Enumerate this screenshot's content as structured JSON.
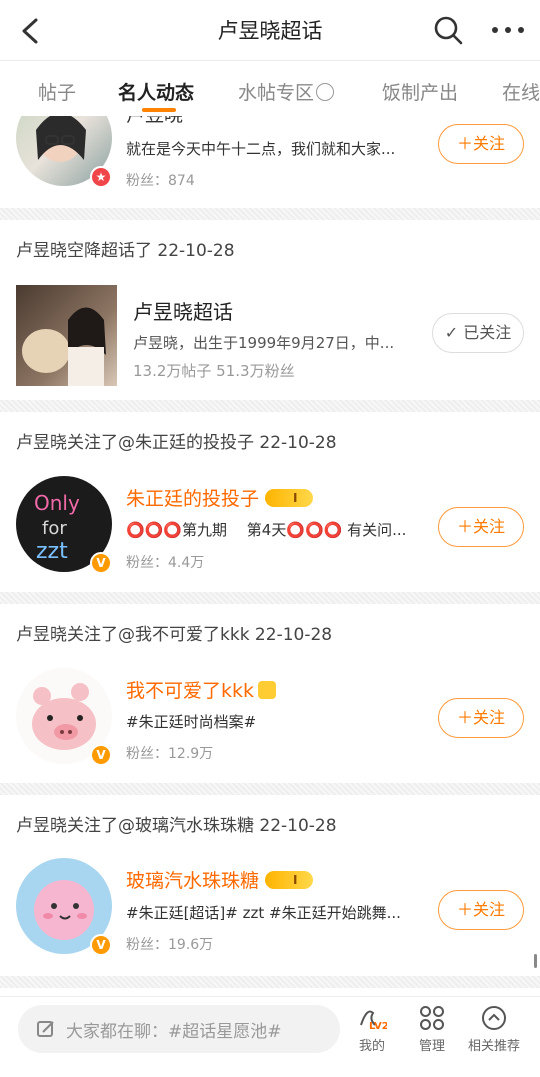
{
  "header": {
    "title": "卢昱晓超话"
  },
  "tabs": [
    {
      "label": "帖子"
    },
    {
      "label": "名人动态"
    },
    {
      "label": "水帖专区"
    },
    {
      "label": "饭制产出"
    },
    {
      "label": "在线"
    }
  ],
  "feed": {
    "item0": {
      "name": "卢昱晓",
      "desc": "就在是今天中午十二点，我们就和大家...",
      "fans": "粉丝：874",
      "button": "＋关注"
    },
    "item1": {
      "head": "卢昱晓空降超话了 22-10-28",
      "name": "卢昱晓超话",
      "desc": "卢昱晓，出生于1999年9月27日，中...",
      "stats": "13.2万帖子  51.3万粉丝",
      "button": "✓ 已关注"
    },
    "item2": {
      "head": "卢昱晓关注了@朱正廷的投投子 22-10-28",
      "name": "朱正廷的投投子",
      "desc": "⭕⭕⭕第九期　 第4天⭕⭕⭕ 有关问...",
      "fans": "粉丝：4.4万",
      "button": "＋关注"
    },
    "item3": {
      "head": "卢昱晓关注了@我不可爱了kkk 22-10-28",
      "name": "我不可爱了kkk",
      "desc": "#朱正廷时尚档案#",
      "fans": "粉丝：12.9万",
      "button": "＋关注"
    },
    "item4": {
      "head": "卢昱晓关注了@玻璃汽水珠珠糖 22-10-28",
      "name": "玻璃汽水珠珠糖",
      "desc": "#朱正廷[超话]# zzt #朱正廷开始跳舞...",
      "fans": "粉丝：19.6万",
      "button": "＋关注"
    }
  },
  "bottom": {
    "placeholder": "大家都在聊：#超话星愿池#",
    "nav": [
      {
        "label": "我的",
        "icon": "lv2-icon"
      },
      {
        "label": "管理",
        "icon": "grid-icon"
      },
      {
        "label": "相关推荐",
        "icon": "chevron-up-circle-icon"
      }
    ]
  },
  "colors": {
    "accent": "#ff8200",
    "name": "#ff6a00",
    "muted": "#999999"
  }
}
